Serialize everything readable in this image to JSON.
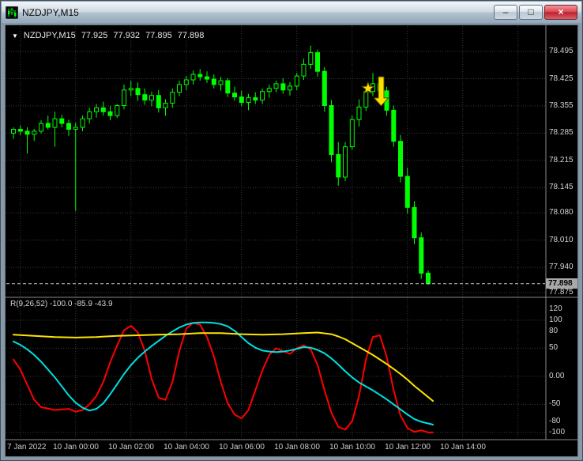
{
  "window": {
    "title": "NZDJPY,M15",
    "controls": [
      {
        "id": "minimize",
        "glyph": "–"
      },
      {
        "id": "maximize",
        "glyph": "□"
      },
      {
        "id": "close",
        "glyph": "×"
      }
    ]
  },
  "chart": {
    "ohlc_header": {
      "expander": "▼",
      "symbol": "NZDJPY,M15",
      "open": "77.925",
      "high": "77.932",
      "low": "77.895",
      "close": "77.898"
    },
    "indicator_header": "R(9,26,52) -100.0 -85.9 -43.9",
    "current_price": "77.898"
  },
  "chart_data": {
    "type": "candlestick",
    "symbol": "NZDJPY",
    "timeframe": "M15",
    "title": "NZDJPY,M15",
    "ohlc_current": {
      "open": 77.925,
      "high": 77.932,
      "low": 77.895,
      "close": 77.898
    },
    "price_axis": {
      "labels": [
        78.495,
        78.425,
        78.355,
        78.285,
        78.215,
        78.145,
        78.08,
        78.01,
        77.94,
        77.875
      ],
      "current": 77.898,
      "ylim": [
        77.871,
        78.546
      ]
    },
    "time_axis": {
      "labels": [
        {
          "text": "7 Jan 2022",
          "i": 1
        },
        {
          "text": "10 Jan 00:00",
          "i": 9
        },
        {
          "text": "10 Jan 02:00",
          "i": 17
        },
        {
          "text": "10 Jan 04:00",
          "i": 25
        },
        {
          "text": "10 Jan 06:00",
          "i": 33
        },
        {
          "text": "10 Jan 08:00",
          "i": 41
        },
        {
          "text": "10 Jan 10:00",
          "i": 49
        },
        {
          "text": "10 Jan 12:00",
          "i": 57
        },
        {
          "text": "10 Jan 14:00",
          "i": 65
        }
      ],
      "grid_only": [
        73
      ]
    },
    "candles": [
      [
        78.285,
        78.3,
        78.27,
        78.295
      ],
      [
        78.295,
        78.305,
        78.28,
        78.29
      ],
      [
        78.29,
        78.3,
        78.232,
        78.282
      ],
      [
        78.282,
        78.296,
        78.265,
        78.29
      ],
      [
        78.29,
        78.318,
        78.284,
        78.31
      ],
      [
        78.31,
        78.33,
        78.294,
        78.3
      ],
      [
        78.3,
        78.34,
        78.25,
        78.322
      ],
      [
        78.322,
        78.332,
        78.3,
        78.31
      ],
      [
        78.31,
        78.32,
        78.278,
        78.295
      ],
      [
        78.295,
        78.312,
        78.085,
        78.3
      ],
      [
        78.3,
        78.33,
        78.29,
        78.322
      ],
      [
        78.322,
        78.35,
        78.31,
        78.34
      ],
      [
        78.34,
        78.36,
        78.325,
        78.35
      ],
      [
        78.35,
        78.366,
        78.33,
        78.34
      ],
      [
        78.34,
        78.355,
        78.318,
        78.33
      ],
      [
        78.33,
        78.36,
        78.324,
        78.356
      ],
      [
        78.356,
        78.41,
        78.346,
        78.396
      ],
      [
        78.396,
        78.42,
        78.38,
        78.4
      ],
      [
        78.4,
        78.415,
        78.368,
        78.384
      ],
      [
        78.384,
        78.4,
        78.358,
        78.37
      ],
      [
        78.37,
        78.392,
        78.354,
        78.382
      ],
      [
        78.382,
        78.396,
        78.338,
        78.35
      ],
      [
        78.35,
        78.372,
        78.33,
        78.362
      ],
      [
        78.362,
        78.4,
        78.35,
        78.39
      ],
      [
        78.39,
        78.42,
        78.38,
        78.41
      ],
      [
        78.41,
        78.432,
        78.396,
        78.422
      ],
      [
        78.422,
        78.446,
        78.41,
        78.436
      ],
      [
        78.436,
        78.45,
        78.42,
        78.43
      ],
      [
        78.43,
        78.444,
        78.414,
        78.424
      ],
      [
        78.424,
        78.436,
        78.4,
        78.41
      ],
      [
        78.41,
        78.43,
        78.394,
        78.42
      ],
      [
        78.42,
        78.426,
        78.378,
        78.388
      ],
      [
        78.388,
        78.404,
        78.368,
        78.378
      ],
      [
        78.378,
        78.394,
        78.354,
        78.364
      ],
      [
        78.364,
        78.386,
        78.344,
        78.376
      ],
      [
        78.376,
        78.39,
        78.36,
        78.37
      ],
      [
        78.37,
        78.4,
        78.36,
        78.392
      ],
      [
        78.392,
        78.41,
        78.376,
        78.4
      ],
      [
        78.4,
        78.42,
        78.39,
        78.412
      ],
      [
        78.412,
        78.426,
        78.386,
        78.396
      ],
      [
        78.396,
        78.416,
        78.382,
        78.406
      ],
      [
        78.406,
        78.44,
        78.396,
        78.432
      ],
      [
        78.432,
        78.476,
        78.422,
        78.462
      ],
      [
        78.462,
        78.51,
        78.45,
        78.492
      ],
      [
        78.492,
        78.5,
        78.43,
        78.444
      ],
      [
        78.444,
        78.455,
        78.34,
        78.356
      ],
      [
        78.356,
        78.37,
        78.21,
        78.23
      ],
      [
        78.23,
        78.262,
        78.15,
        78.172
      ],
      [
        78.172,
        78.262,
        78.162,
        78.25
      ],
      [
        78.25,
        78.33,
        78.242,
        78.32
      ],
      [
        78.32,
        78.372,
        78.302,
        78.352
      ],
      [
        78.352,
        78.402,
        78.342,
        78.392
      ],
      [
        78.392,
        78.44,
        78.38,
        78.412
      ],
      [
        78.412,
        78.43,
        78.378,
        78.394
      ],
      [
        78.394,
        78.404,
        78.33,
        78.344
      ],
      [
        78.344,
        78.356,
        78.25,
        78.264
      ],
      [
        78.264,
        78.28,
        78.158,
        78.174
      ],
      [
        78.174,
        78.196,
        78.078,
        78.094
      ],
      [
        78.094,
        78.11,
        78.0,
        78.016
      ],
      [
        78.016,
        78.03,
        77.91,
        77.925
      ],
      [
        77.925,
        77.932,
        77.895,
        77.898
      ]
    ],
    "indicator": {
      "name": "R(9,26,52)",
      "current_values": [
        -100.0,
        -85.9,
        -43.9
      ],
      "axis_labels": [
        {
          "text": "120",
          "v": 120
        },
        {
          "text": "100",
          "v": 100
        },
        {
          "text": "80",
          "v": 80
        },
        {
          "text": "50",
          "v": 50
        },
        {
          "text": "0.00",
          "v": 0
        },
        {
          "text": "-50",
          "v": -50
        },
        {
          "text": "-80",
          "v": -80
        },
        {
          "text": "-100",
          "v": -100
        }
      ],
      "levels": [
        100,
        50,
        0,
        -50,
        -100
      ],
      "vlim": [
        -110,
        135
      ],
      "series": [
        {
          "name": "fast-red",
          "color": "#ff0000",
          "points": [
            [
              0,
              30
            ],
            [
              1,
              12
            ],
            [
              2,
              -15
            ],
            [
              3,
              -42
            ],
            [
              4,
              -55
            ],
            [
              6,
              -60
            ],
            [
              8,
              -58
            ],
            [
              9,
              -63
            ],
            [
              10,
              -60
            ],
            [
              11,
              -50
            ],
            [
              12,
              -35
            ],
            [
              13,
              -10
            ],
            [
              14,
              25
            ],
            [
              15,
              55
            ],
            [
              16,
              82
            ],
            [
              17,
              90
            ],
            [
              18,
              78
            ],
            [
              19,
              45
            ],
            [
              20,
              -5
            ],
            [
              21,
              -38
            ],
            [
              22,
              -42
            ],
            [
              23,
              -10
            ],
            [
              24,
              45
            ],
            [
              25,
              85
            ],
            [
              26,
              95
            ],
            [
              27,
              92
            ],
            [
              28,
              70
            ],
            [
              29,
              35
            ],
            [
              30,
              -10
            ],
            [
              31,
              -48
            ],
            [
              32,
              -68
            ],
            [
              33,
              -75
            ],
            [
              34,
              -60
            ],
            [
              35,
              -25
            ],
            [
              36,
              10
            ],
            [
              37,
              38
            ],
            [
              38,
              50
            ],
            [
              39,
              45
            ],
            [
              40,
              40
            ],
            [
              41,
              50
            ],
            [
              42,
              55
            ],
            [
              43,
              48
            ],
            [
              44,
              20
            ],
            [
              45,
              -25
            ],
            [
              46,
              -65
            ],
            [
              47,
              -90
            ],
            [
              48,
              -95
            ],
            [
              49,
              -80
            ],
            [
              50,
              -35
            ],
            [
              51,
              30
            ],
            [
              52,
              70
            ],
            [
              53,
              73
            ],
            [
              54,
              35
            ],
            [
              55,
              -25
            ],
            [
              56,
              -70
            ],
            [
              57,
              -92
            ],
            [
              58,
              -99
            ],
            [
              59,
              -96
            ],
            [
              60,
              -100
            ],
            [
              60.7,
              -100
            ]
          ]
        },
        {
          "name": "mid-aqua",
          "color": "#00e0e0",
          "points": [
            [
              0,
              62
            ],
            [
              1,
              56
            ],
            [
              2,
              48
            ],
            [
              3,
              38
            ],
            [
              4,
              26
            ],
            [
              5,
              12
            ],
            [
              6,
              -2
            ],
            [
              7,
              -18
            ],
            [
              8,
              -34
            ],
            [
              9,
              -47
            ],
            [
              10,
              -56
            ],
            [
              11,
              -61
            ],
            [
              12,
              -58
            ],
            [
              13,
              -48
            ],
            [
              14,
              -32
            ],
            [
              15,
              -14
            ],
            [
              16,
              4
            ],
            [
              17,
              20
            ],
            [
              18,
              33
            ],
            [
              19,
              44
            ],
            [
              20,
              54
            ],
            [
              21,
              63
            ],
            [
              22,
              72
            ],
            [
              23,
              80
            ],
            [
              24,
              87
            ],
            [
              25,
              92
            ],
            [
              26,
              95
            ],
            [
              27,
              96
            ],
            [
              28,
              96
            ],
            [
              29,
              95
            ],
            [
              30,
              93
            ],
            [
              31,
              89
            ],
            [
              32,
              81
            ],
            [
              33,
              70
            ],
            [
              34,
              59
            ],
            [
              35,
              51
            ],
            [
              36,
              46
            ],
            [
              37,
              44
            ],
            [
              38,
              43
            ],
            [
              39,
              44
            ],
            [
              40,
              46
            ],
            [
              41,
              49
            ],
            [
              42,
              52
            ],
            [
              43,
              51
            ],
            [
              44,
              47
            ],
            [
              45,
              41
            ],
            [
              46,
              32
            ],
            [
              47,
              21
            ],
            [
              48,
              9
            ],
            [
              49,
              -2
            ],
            [
              50,
              -11
            ],
            [
              51,
              -18
            ],
            [
              52,
              -25
            ],
            [
              53,
              -33
            ],
            [
              54,
              -41
            ],
            [
              55,
              -50
            ],
            [
              56,
              -59
            ],
            [
              57,
              -68
            ],
            [
              58,
              -76
            ],
            [
              59,
              -81
            ],
            [
              60,
              -84
            ],
            [
              60.7,
              -86
            ]
          ]
        },
        {
          "name": "slow-yellow",
          "color": "#ffe400",
          "points": [
            [
              0,
              74
            ],
            [
              3,
              72
            ],
            [
              6,
              70
            ],
            [
              9,
              69
            ],
            [
              12,
              70
            ],
            [
              15,
              72
            ],
            [
              18,
              73
            ],
            [
              21,
              74
            ],
            [
              24,
              75
            ],
            [
              27,
              77
            ],
            [
              30,
              77
            ],
            [
              33,
              75
            ],
            [
              36,
              74
            ],
            [
              39,
              75
            ],
            [
              42,
              77
            ],
            [
              44,
              78
            ],
            [
              46,
              75
            ],
            [
              47,
              71
            ],
            [
              48,
              66
            ],
            [
              49,
              59
            ],
            [
              50,
              52
            ],
            [
              51,
              45
            ],
            [
              52,
              38
            ],
            [
              53,
              30
            ],
            [
              54,
              22
            ],
            [
              55,
              13
            ],
            [
              56,
              4
            ],
            [
              57,
              -6
            ],
            [
              58,
              -17
            ],
            [
              59,
              -27
            ],
            [
              60,
              -37
            ],
            [
              60.7,
              -44
            ]
          ]
        }
      ]
    },
    "markers": {
      "star": {
        "i": 51.3,
        "price": 78.4
      },
      "sell_arrow": {
        "i": 53.2,
        "price_top": 78.43,
        "price_tip": 78.355
      }
    },
    "colors": {
      "background": "#000000",
      "grid": "#3a3a3a",
      "candle": "#00ff00",
      "bull_fill": "#000000",
      "bear_fill": "#00ff00",
      "price_line": "#c8c8c8",
      "price_box_bg": "#a8a8a8",
      "separator": "#8a8a8a",
      "marker": "#ffdf00"
    }
  }
}
